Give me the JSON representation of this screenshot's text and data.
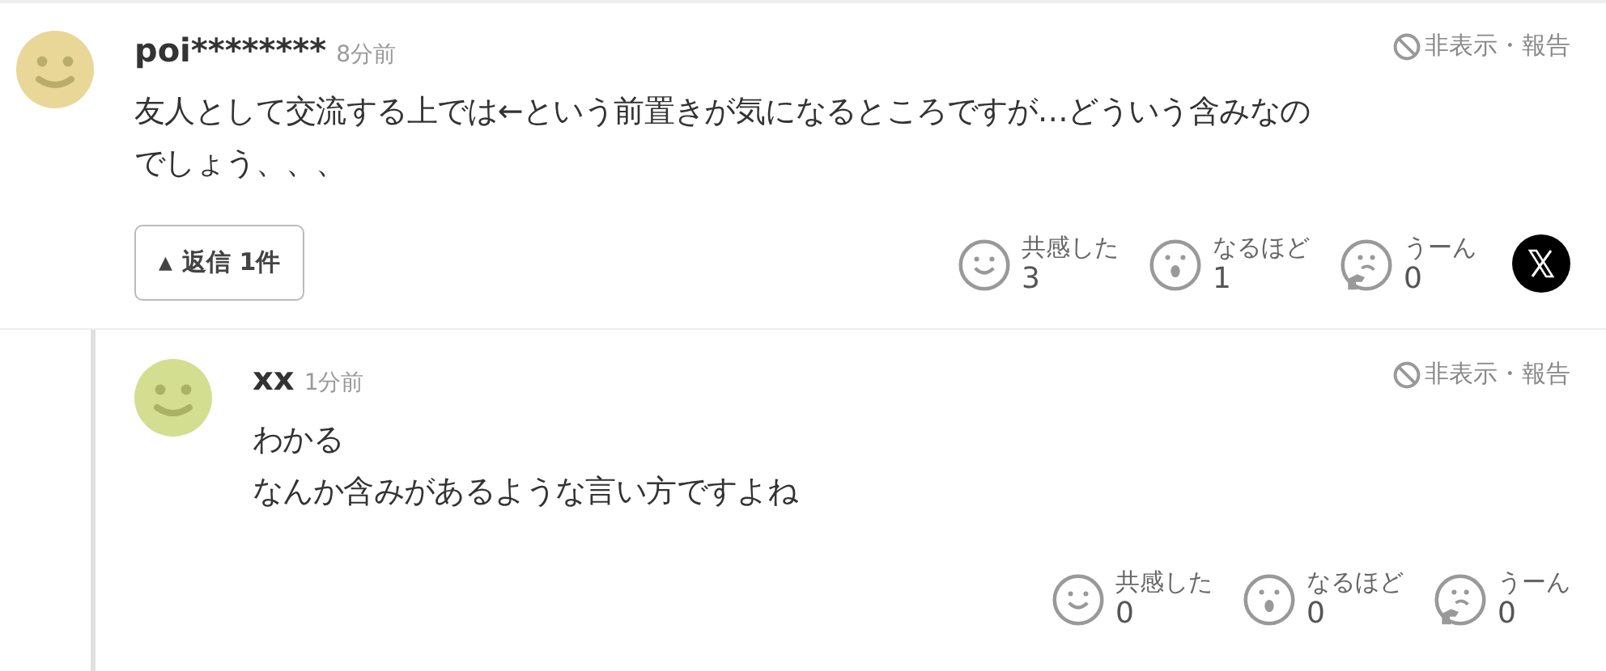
{
  "comments": [
    {
      "author": "poi********",
      "time": "8分前",
      "color": "#e8d796",
      "report": "非表示・報告",
      "lines": [
        "友人として交流する上では←という前置きが気になるところですが…どういう含みなの",
        "でしょう、、、"
      ],
      "reply_button": {
        "icon": "▲",
        "label": "返信 1件"
      },
      "share": true,
      "reactions": [
        {
          "kind": "smile",
          "label": "共感した",
          "count": "3"
        },
        {
          "kind": "wow",
          "label": "なるほど",
          "count": "1"
        },
        {
          "kind": "hmm",
          "label": "うーん",
          "count": "0"
        }
      ]
    },
    {
      "author": "xx",
      "time": "1分前",
      "color": "#d3de91",
      "report": "非表示・報告",
      "lines": [
        "わかる",
        "なんか含みがあるような言い方ですよね"
      ],
      "reactions": [
        {
          "kind": "smile",
          "label": "共感した",
          "count": "0"
        },
        {
          "kind": "wow",
          "label": "なるほど",
          "count": "0"
        },
        {
          "kind": "hmm",
          "label": "うーん",
          "count": "0"
        }
      ]
    }
  ]
}
